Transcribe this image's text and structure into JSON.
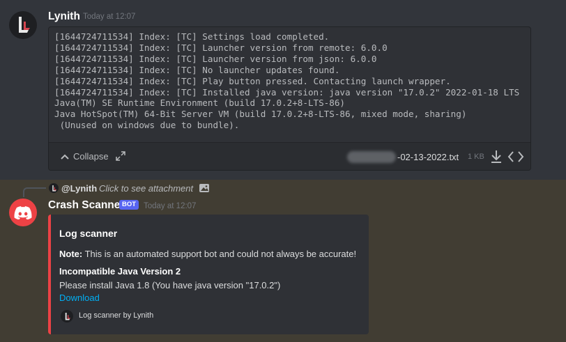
{
  "message1": {
    "author": "Lynith",
    "timestamp": "Today at 12:07",
    "attachment": {
      "lines": [
        "[1644724711534] Index: [TC] Settings load completed.",
        "[1644724711534] Index: [TC] Launcher version from remote: 6.0.0",
        "[1644724711534] Index: [TC] Launcher version from json: 6.0.0",
        "[1644724711534] Index: [TC] No launcher updates found.",
        "[1644724711534] Index: [TC] Play button pressed. Contacting launch wrapper.",
        "[1644724711534] Index: [TC] Installed java version: java version \"17.0.2\" 2022-01-18 LTS",
        "Java(TM) SE Runtime Environment (build 17.0.2+8-LTS-86)",
        "Java HotSpot(TM) 64-Bit Server VM (build 17.0.2+8-LTS-86, mixed mode, sharing)",
        " (Unused on windows due to bundle)."
      ],
      "collapse_label": "Collapse",
      "filename": "-02-13-2022.txt",
      "filesize": "1 KB",
      "icons": [
        "chevron-up-icon",
        "expand-icon",
        "download-icon",
        "code-icon"
      ]
    }
  },
  "message2": {
    "reply": {
      "mention": "@Lynith",
      "text": "Click to see attachment",
      "icon": "image-icon"
    },
    "author": "Crash Scanner",
    "bot_tag": "BOT",
    "timestamp": "Today at 12:07",
    "embed": {
      "accent_color": "#ed4245",
      "title": "Log scanner",
      "note_label": "Note:",
      "note_text": " This is an automated support bot and could not always be accurate!",
      "field_name": "Incompatible Java Version 2",
      "field_value": "Please install Java 1.8 (You have java version \"17.0.2\")",
      "link_text": "Download",
      "footer": "Log scanner by Lynith"
    }
  },
  "colors": {
    "background": "#36393f",
    "highlight": "#413d33",
    "blurple": "#5865f2",
    "link": "#00aff4"
  }
}
